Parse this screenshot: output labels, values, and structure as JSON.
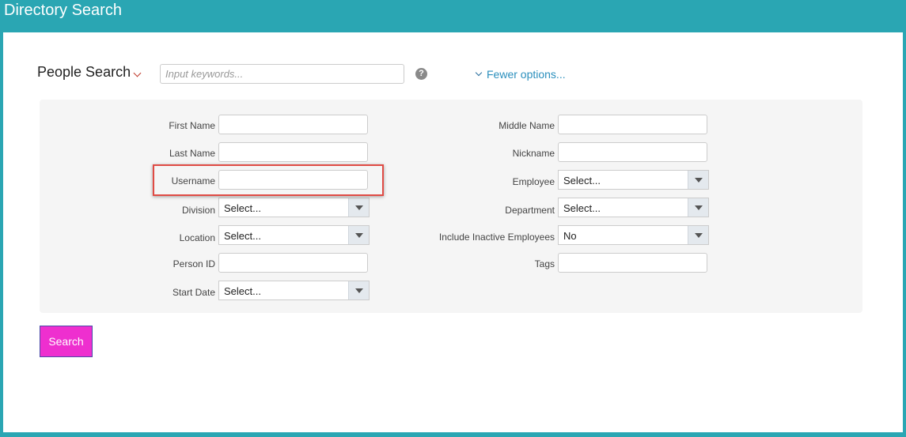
{
  "header": {
    "title": "Directory Search"
  },
  "search_bar": {
    "search_type": "People Search",
    "keyword_placeholder": "Input keywords...",
    "help_glyph": "?",
    "fewer_options": "Fewer options..."
  },
  "fields_left": [
    {
      "label": "First Name",
      "type": "text",
      "value": ""
    },
    {
      "label": "Last Name",
      "type": "text",
      "value": ""
    },
    {
      "label": "Username",
      "type": "text",
      "value": ""
    },
    {
      "label": "Division",
      "type": "select",
      "value": "Select..."
    },
    {
      "label": "Location",
      "type": "select",
      "value": "Select..."
    },
    {
      "label": "Person ID",
      "type": "text",
      "value": ""
    },
    {
      "label": "Start Date",
      "type": "select",
      "value": "Select..."
    }
  ],
  "fields_right": [
    {
      "label": "Middle Name",
      "type": "text",
      "value": ""
    },
    {
      "label": "Nickname",
      "type": "text",
      "value": ""
    },
    {
      "label": "Employee",
      "type": "select",
      "value": "Select..."
    },
    {
      "label": "Department",
      "type": "select",
      "value": "Select..."
    },
    {
      "label": "Include Inactive Employees",
      "type": "select",
      "value": "No"
    },
    {
      "label": "Tags",
      "type": "text",
      "value": ""
    }
  ],
  "actions": {
    "search_label": "Search"
  },
  "colors": {
    "header_bg": "#2aa6b3",
    "link": "#2a8fbd",
    "search_button": "#ee2fcf",
    "highlight": "#e04b44"
  }
}
